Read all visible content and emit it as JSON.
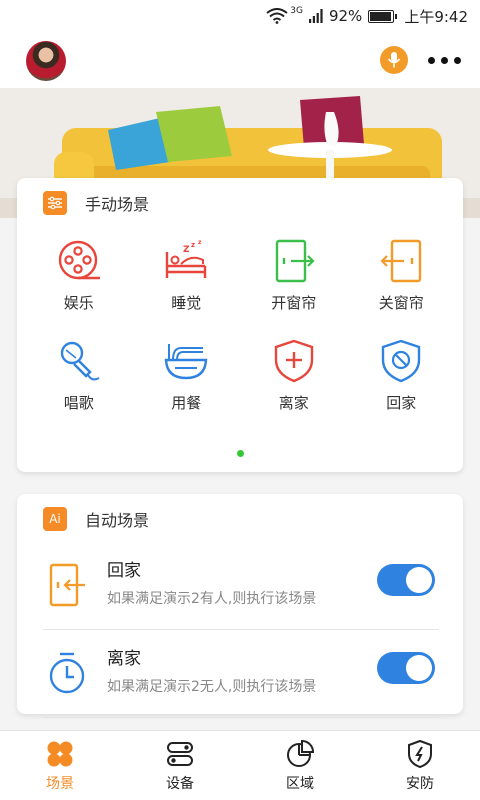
{
  "status_bar": {
    "network": "3G",
    "battery": "92%",
    "time": "上午9:42"
  },
  "header": {
    "avatar": "user-avatar",
    "mic_icon": "microphone-icon",
    "more_icon": "more-dots-icon"
  },
  "manual": {
    "title": "手动场景",
    "badge_icon": "sliders-icon",
    "scenes": [
      {
        "label": "娱乐",
        "icon": "film-reel-icon",
        "color": "#e8453c"
      },
      {
        "label": "睡觉",
        "icon": "bed-icon",
        "color": "#e8453c"
      },
      {
        "label": "开窗帘",
        "icon": "open-curtain-icon",
        "color": "#3cbf4a"
      },
      {
        "label": "关窗帘",
        "icon": "close-curtain-icon",
        "color": "#f39b29"
      },
      {
        "label": "唱歌",
        "icon": "microphone-icon",
        "color": "#2f82e0"
      },
      {
        "label": "用餐",
        "icon": "noodle-bowl-icon",
        "color": "#2f82e0"
      },
      {
        "label": "离家",
        "icon": "shield-plus-icon",
        "color": "#e8453c"
      },
      {
        "label": "回家",
        "icon": "shield-ban-icon",
        "color": "#2f82e0"
      }
    ]
  },
  "auto": {
    "title": "自动场景",
    "badge": "Ai",
    "rules": [
      {
        "name": "回家",
        "desc": "如果满足演示2有人,则执行该场景",
        "icon": "door-enter-icon",
        "enabled": true
      },
      {
        "name": "离家",
        "desc": "如果满足演示2无人,则执行该场景",
        "icon": "timer-icon",
        "enabled": true
      }
    ]
  },
  "nav": [
    {
      "label": "场景",
      "icon": "clover-icon",
      "active": true
    },
    {
      "label": "设备",
      "icon": "toggle-icon",
      "active": false
    },
    {
      "label": "区域",
      "icon": "pie-chart-icon",
      "active": false
    },
    {
      "label": "安防",
      "icon": "shield-bolt-icon",
      "active": false
    }
  ],
  "colors": {
    "accent": "#f58b25",
    "primary": "#2f82e0",
    "red": "#e8453c",
    "green": "#3cbf4a"
  }
}
